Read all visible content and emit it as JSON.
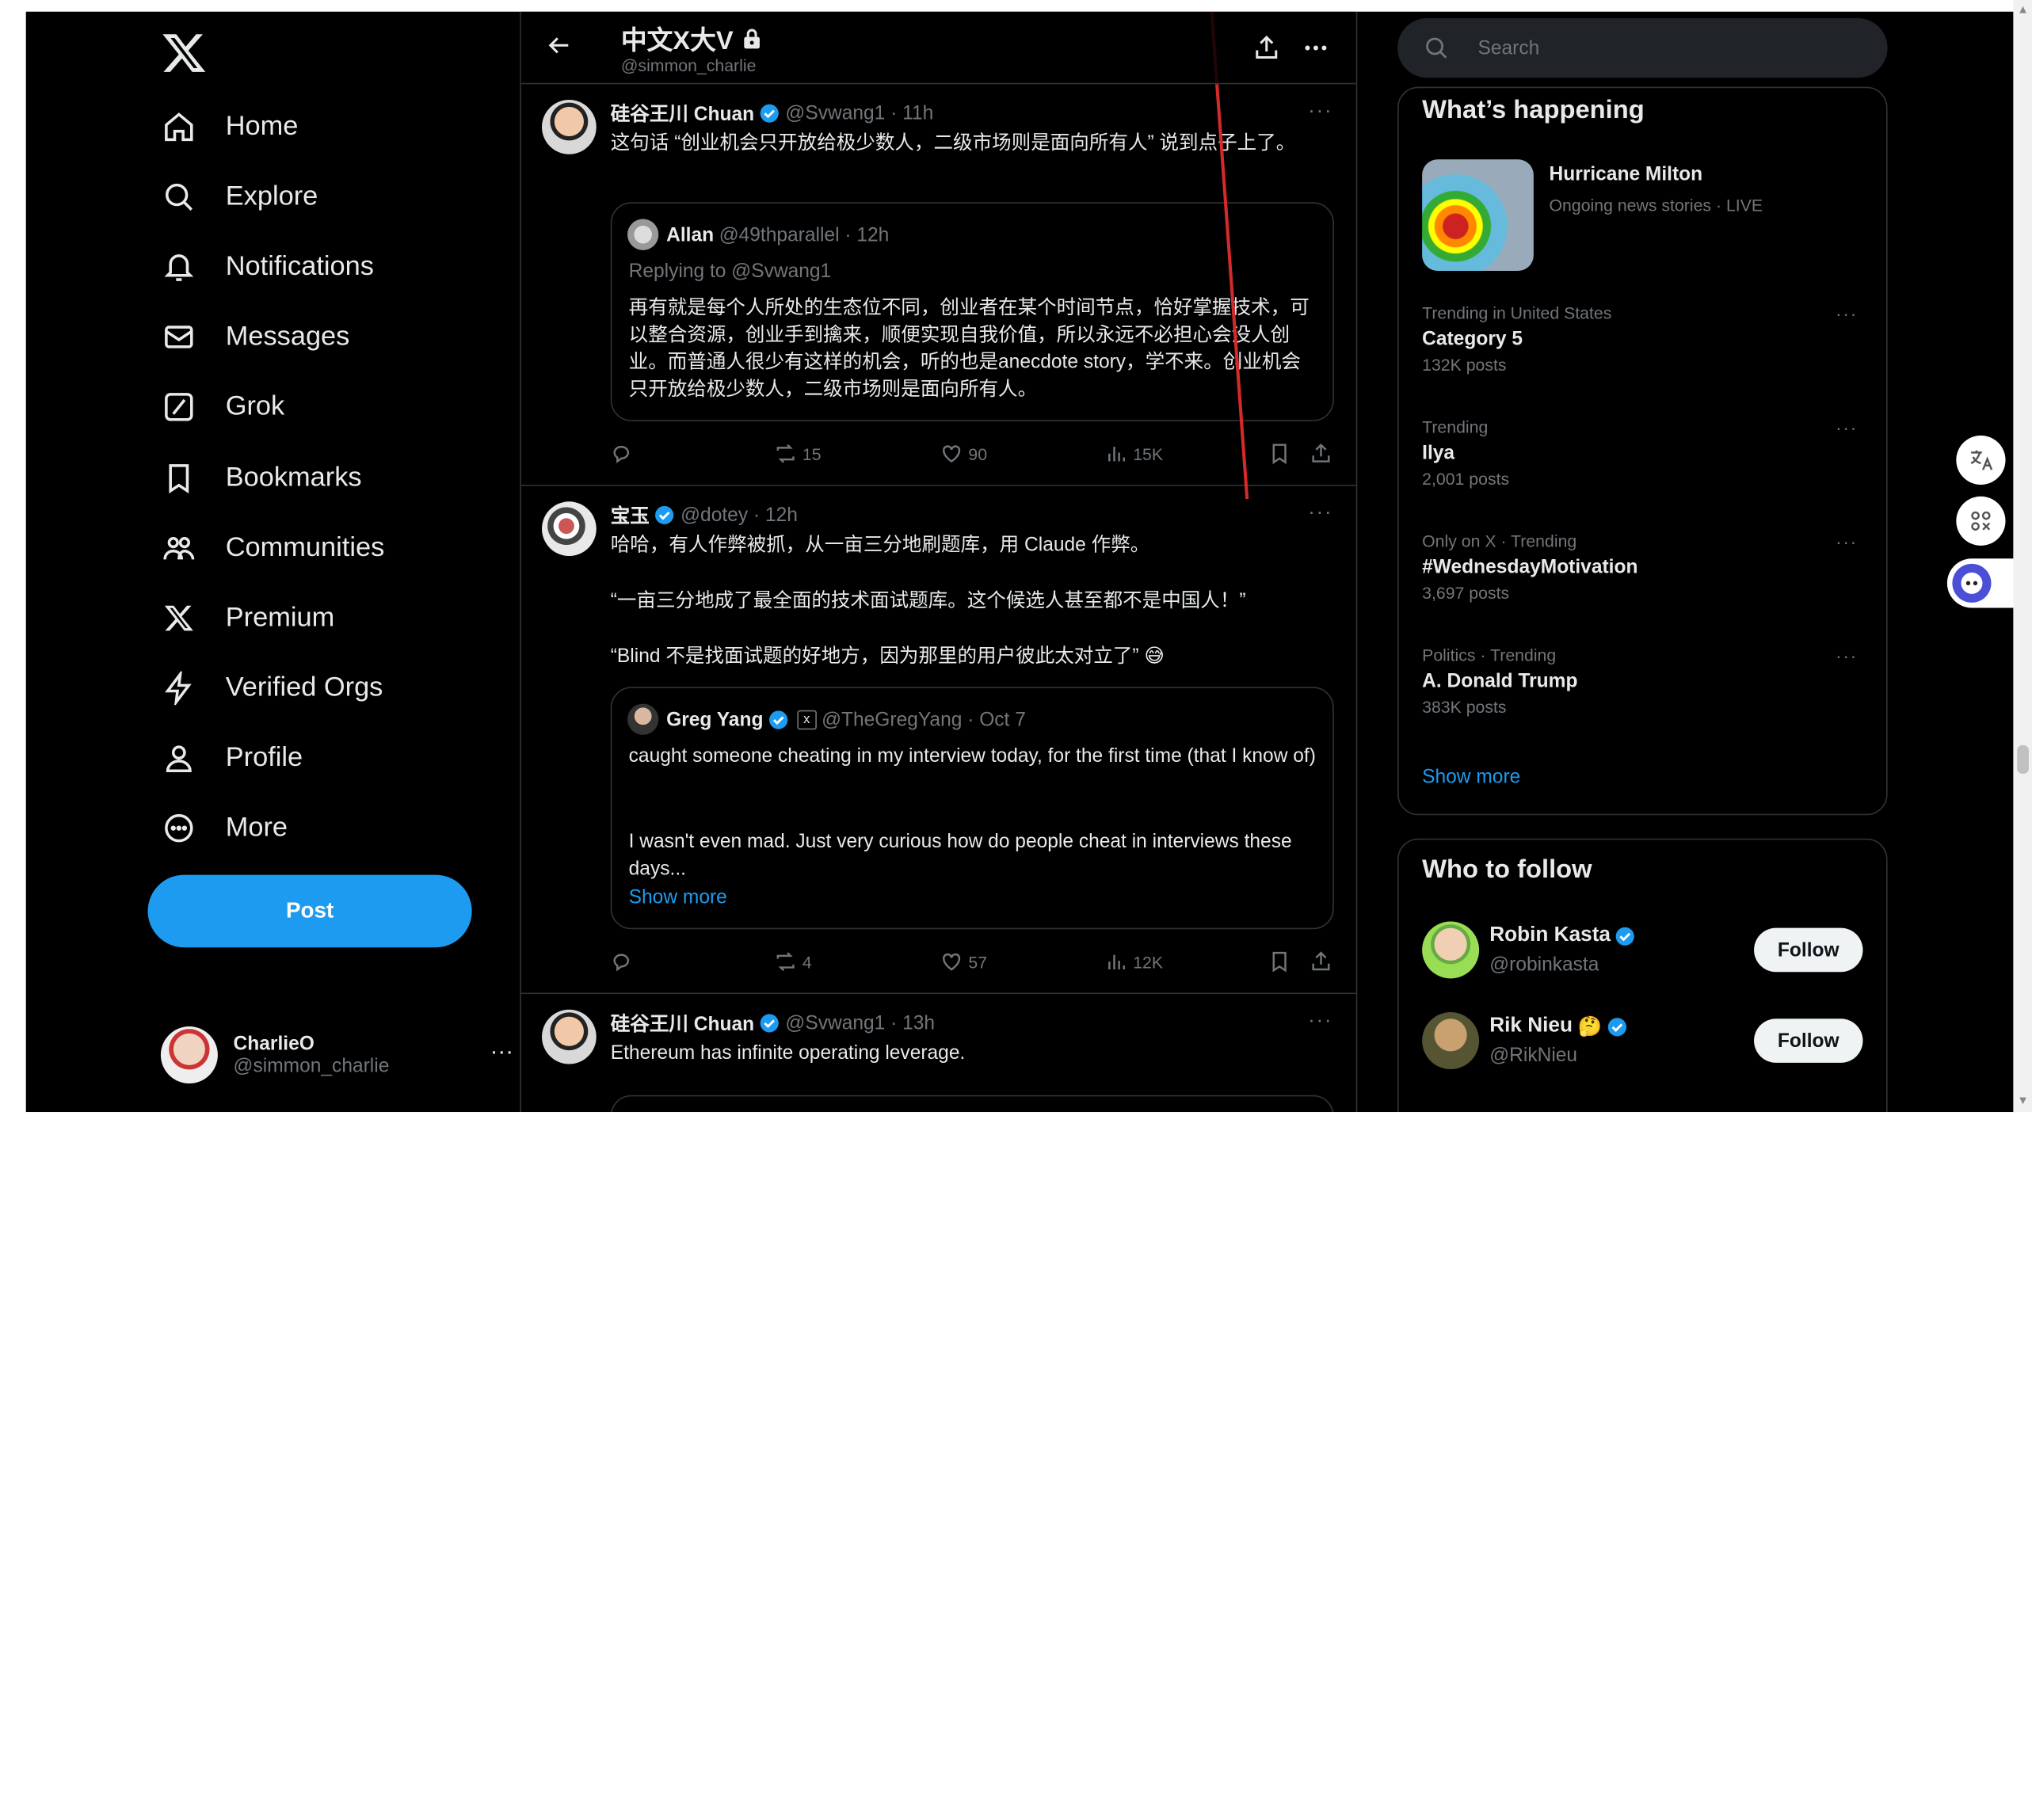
{
  "sidebar": {
    "nav": [
      {
        "label": "Home",
        "icon": "home-icon"
      },
      {
        "label": "Explore",
        "icon": "search-icon"
      },
      {
        "label": "Notifications",
        "icon": "bell-icon"
      },
      {
        "label": "Messages",
        "icon": "mail-icon"
      },
      {
        "label": "Grok",
        "icon": "grok-icon"
      },
      {
        "label": "Bookmarks",
        "icon": "bookmark-icon"
      },
      {
        "label": "Communities",
        "icon": "communities-icon"
      },
      {
        "label": "Premium",
        "icon": "x-logo-icon"
      },
      {
        "label": "Verified Orgs",
        "icon": "lightning-icon"
      },
      {
        "label": "Profile",
        "icon": "person-icon"
      },
      {
        "label": "More",
        "icon": "more-circle-icon"
      }
    ],
    "post_label": "Post",
    "account": {
      "name": "CharlieO",
      "handle": "@simmon_charlie"
    }
  },
  "header": {
    "title": "中文X大V",
    "handle": "@simmon_charlie"
  },
  "tweets": [
    {
      "name": "硅谷王川 Chuan",
      "handle": "@Svwang1 · 11h",
      "text": "这句话 “创业机会只开放给极少数人，二级市场则是面向所有人” 说到点子上了。",
      "quote": {
        "name": "Allan",
        "handle": "@49thparallel · 12h",
        "reply": "Replying to @Svwang1",
        "text": "再有就是每个人所处的生态位不同，创业者在某个时间节点，恰好掌握技术，可以整合资源，创业手到擒来，顺便实现自我价值，所以永远不必担心会没人创业。而普通人很少有这样的机会，听的也是anecdote story，学不来。创业机会只开放给极少数人，二级市场则是面向所有人。"
      },
      "stats": {
        "reposts": "15",
        "likes": "90",
        "views": "15K"
      }
    },
    {
      "name": "宝玉",
      "handle": "@dotey · 12h",
      "text_lines": [
        "哈哈，有人作弊被抓，从一亩三分地刷题库，用 Claude 作弊。",
        "“一亩三分地成了最全面的技术面试题库。这个候选人甚至都不是中国人！”",
        "“Blind 不是找面试题的好地方，因为那里的用户彼此太对立了” 😅"
      ],
      "quote": {
        "name": "Greg Yang",
        "handle": "@TheGregYang · Oct 7",
        "text1": "caught someone cheating in my interview today, for the first time (that I know of)",
        "text2": "I wasn't even mad. Just very curious how do people cheat in interviews these days...",
        "show_more": "Show more"
      },
      "stats": {
        "reposts": "4",
        "likes": "57",
        "views": "12K"
      }
    },
    {
      "name": "硅谷王川 Chuan",
      "handle": "@Svwang1 · 13h",
      "text": "Ethereum has infinite operating leverage."
    }
  ],
  "right": {
    "search_placeholder": "Search",
    "whats_happening": {
      "title": "What’s happening",
      "featured": {
        "title": "Hurricane Milton",
        "sub": "Ongoing news stories · LIVE"
      },
      "trends": [
        {
          "context": "Trending in United States",
          "title": "Category 5",
          "count": "132K posts"
        },
        {
          "context": "Trending",
          "title": "Ilya",
          "count": "2,001 posts"
        },
        {
          "context": "Only on X · Trending",
          "title": "#WednesdayMotivation",
          "count": "3,697 posts"
        },
        {
          "context": "Politics · Trending",
          "title": "A. Donald Trump",
          "count": "383K posts"
        }
      ],
      "show_more": "Show more"
    },
    "who_to_follow": {
      "title": "Who to follow",
      "users": [
        {
          "name": "Robin Kasta",
          "handle": "@robinkasta",
          "button": "Follow"
        },
        {
          "name": "Rik Nieu",
          "handle": "@RikNieu",
          "button": "Follow"
        }
      ]
    }
  },
  "colors": {
    "accent": "#1d9bf0",
    "bg": "#000000",
    "border": "#2f3336",
    "muted": "#71767b",
    "text": "#e7e9ea"
  }
}
